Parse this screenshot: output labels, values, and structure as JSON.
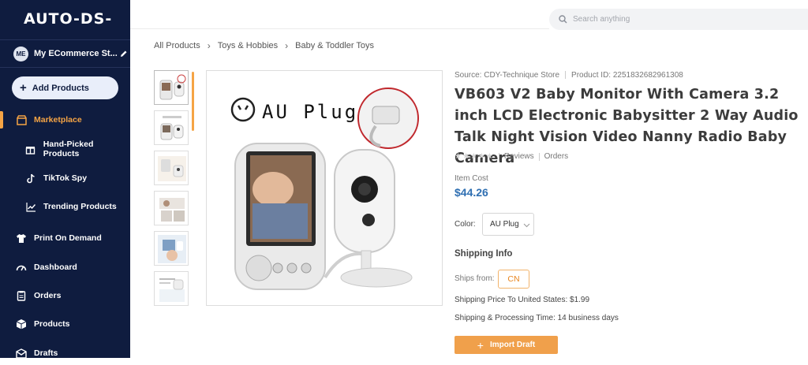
{
  "sidebar": {
    "logo": "AUTO-DS-",
    "store": {
      "avatar": "ME",
      "name": "My ECommerce St..."
    },
    "add_button": "Add Products",
    "items": [
      {
        "label": "Marketplace",
        "icon": "store-icon",
        "active": true
      },
      {
        "label": "Hand-Picked Products",
        "icon": "gift-icon"
      },
      {
        "label": "TikTok Spy",
        "icon": "tiktok-icon"
      },
      {
        "label": "Trending Products",
        "icon": "trending-icon"
      },
      {
        "label": "Print On Demand",
        "icon": "shirt-icon"
      },
      {
        "label": "Dashboard",
        "icon": "gauge-icon"
      },
      {
        "label": "Orders",
        "icon": "clipboard-icon"
      },
      {
        "label": "Products",
        "icon": "box-icon"
      },
      {
        "label": "Drafts",
        "icon": "draft-icon"
      }
    ]
  },
  "search": {
    "placeholder": "Search anything"
  },
  "breadcrumb": [
    "All Products",
    "Toys & Hobbies",
    "Baby & Toddler Toys"
  ],
  "product": {
    "source": "Source: CDY-Technique Store",
    "product_id": "Product ID: 2251832682961308",
    "title": "VB603 V2 Baby Monitor With Camera 3.2 inch LCD Electronic Babysitter 2 Way Audio Talk Night Vision Video Nanny Radio Baby Camera",
    "stars": "★★★★★",
    "reviews": "Reviews",
    "orders": "Orders",
    "cost_label": "Item Cost",
    "price": "$44.26",
    "color_label": "Color:",
    "color_value": "AU Plug",
    "image_caption": "AU Plug",
    "shipping_heading": "Shipping Info",
    "ships_from_label": "Ships from:",
    "ships_from_value": "CN",
    "shipping_price": "Shipping Price To United States:  $1.99",
    "shipping_time": "Shipping & Processing Time:  14 business days",
    "import_button": "Import Draft"
  },
  "colors": {
    "sidebar_bg": "#0f1c3f",
    "accent": "#f5a445",
    "price": "#2f6fb2"
  }
}
